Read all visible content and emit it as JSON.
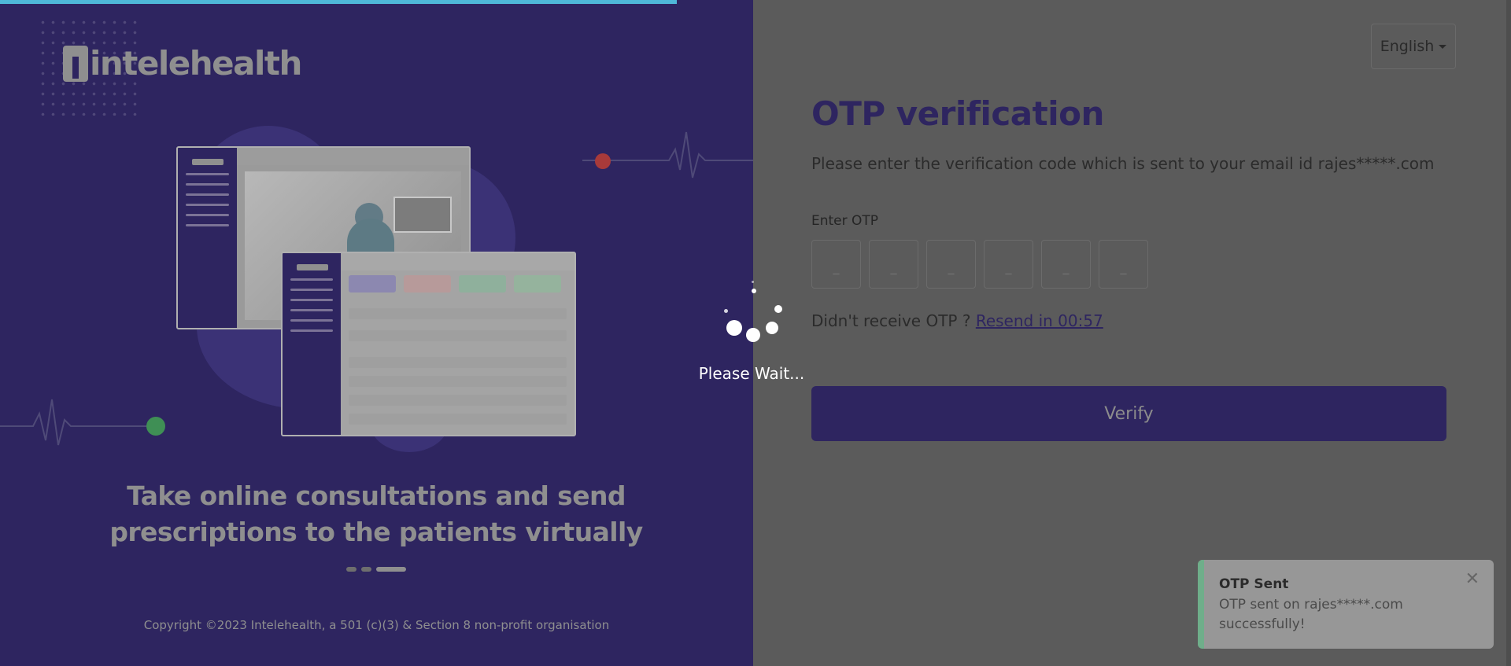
{
  "progress": {
    "fraction": 0.448,
    "color": "#4fb8d8"
  },
  "brand": {
    "logo_text": "intelehealth"
  },
  "hero": {
    "tagline": "Take online consultations and send prescriptions to the patients virtually",
    "carousel": {
      "count": 3,
      "active_index": 2
    }
  },
  "footer": {
    "copyright": "Copyright ©2023 Intelehealth, a 501 (c)(3) & Section 8 non-profit organisation"
  },
  "language": {
    "selected": "English"
  },
  "otp": {
    "title": "OTP verification",
    "description": "Please enter the verification code which is sent to your email id rajes*****.com",
    "input_label": "Enter OTP",
    "digits": [
      "",
      "",
      "",
      "",
      "",
      ""
    ],
    "digit_placeholder": "_",
    "resend_prompt": "Didn't receive OTP ?",
    "resend_link": "Resend in 00:57",
    "verify_label": "Verify"
  },
  "loader": {
    "text": "Please Wait..."
  },
  "toast": {
    "title": "OTP Sent",
    "message": "OTP sent on rajes*****.com successfully!",
    "close_glyph": "✕"
  },
  "colors": {
    "brand_dark": "#2e2560",
    "overlay_gray": "#5b5b5b",
    "toast_accent": "#6fae8a",
    "pulse_red": "#a83a3a",
    "pulse_green": "#3f8f55"
  }
}
